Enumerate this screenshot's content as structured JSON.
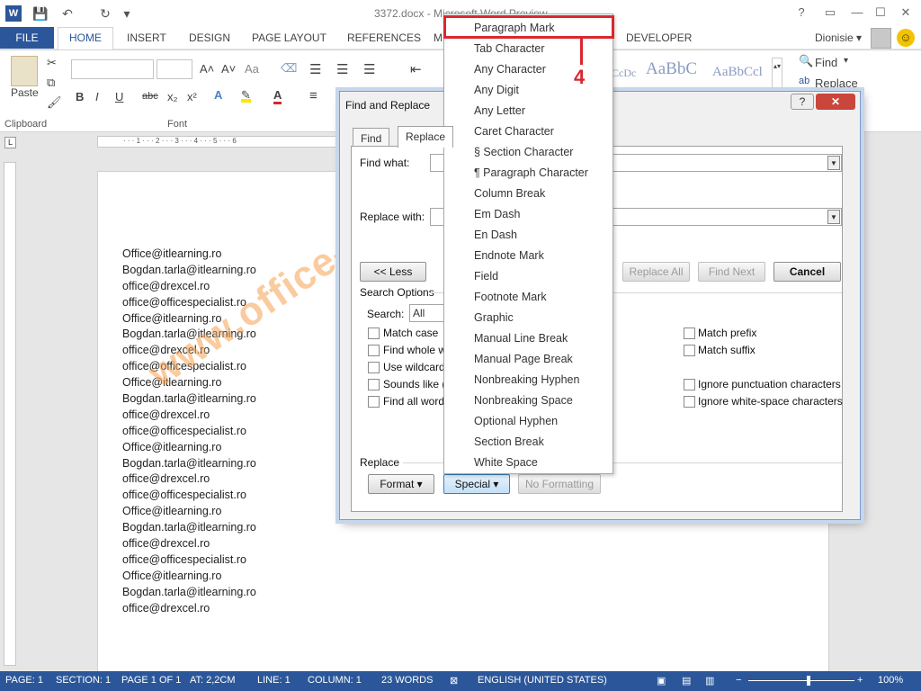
{
  "window": {
    "title": "3372.docx - Microsoft Word Preview",
    "controls": [
      "?",
      "▭",
      "—",
      "☐",
      "✕"
    ]
  },
  "qat": {
    "logo": "W",
    "save_icon": "💾",
    "undo_icon": "↶",
    "redo_icon": "↻",
    "customize_icon": "▾"
  },
  "tabs": {
    "file": "FILE",
    "home": "HOME",
    "items": [
      "INSERT",
      "DESIGN",
      "PAGE LAYOUT",
      "REFERENCES",
      "M",
      "DEVELOPER"
    ]
  },
  "user": {
    "name": "Dionisie ▾",
    "smile": "☺"
  },
  "ribbon": {
    "paste": "Paste",
    "group_labels": {
      "clipboard": "Clipboard",
      "font": "Font"
    },
    "font_buttons": [
      "B",
      "I",
      "U",
      "abc",
      "x₂",
      "x²"
    ],
    "grow_font": "A˄",
    "shrink_font": "A˅",
    "change_case": "Aa",
    "styles": [
      "CcDc",
      "AaBbC",
      "AaBbCcl"
    ],
    "find": "Find",
    "find_arrow": "▾",
    "replace": "Replace"
  },
  "ruler": {
    "marks": "· · · 1 · · · 2 · · · 3 · · · 4 · · · 5 · · · 6"
  },
  "document": {
    "lines": [
      "Office@itlearning.ro",
      "Bogdan.tarla@itlearning.ro",
      "office@drexcel.ro",
      "office@officespecialist.ro",
      "Office@itlearning.ro",
      "Bogdan.tarla@itlearning.ro",
      "office@drexcel.ro",
      "office@officespecialist.ro",
      "Office@itlearning.ro",
      "Bogdan.tarla@itlearning.ro",
      "office@drexcel.ro",
      "office@officespecialist.ro",
      "Office@itlearning.ro",
      "Bogdan.tarla@itlearning.ro",
      "office@drexcel.ro",
      "office@officespecialist.ro",
      "Office@itlearning.ro",
      "Bogdan.tarla@itlearning.ro",
      "office@drexcel.ro",
      "office@officespecialist.ro",
      "Office@itlearning.ro",
      "Bogdan.tarla@itlearning.ro",
      "office@drexcel.ro"
    ]
  },
  "watermark": "www.office-learning.ro",
  "dialog": {
    "title": "Find and Replace",
    "help": "?",
    "close": "✕",
    "tab_find": "Find",
    "tab_replace": "Replace",
    "find_what": "Find what:",
    "replace_with": "Replace with:",
    "less_button": "<< Less",
    "replace_all": "Replace All",
    "find_next": "Find Next",
    "cancel": "Cancel",
    "search_options": "Search Options",
    "search_label": "Search:",
    "search_value": "All",
    "left_options": [
      "Match case",
      "Find whole w",
      "Use wildcard",
      "Sounds like (",
      "Find all word"
    ],
    "right_options_top": [
      "Match prefix",
      "Match suffix"
    ],
    "right_options_bottom": [
      "Ignore punctuation characters",
      "Ignore white-space characters"
    ],
    "replace_section": "Replace",
    "format_button": "Format ▾",
    "special_button": "Special ▾",
    "no_formatting": "No Formatting"
  },
  "special_menu": [
    "Paragraph Mark",
    "Tab Character",
    "Any Character",
    "Any Digit",
    "Any Letter",
    "Caret Character",
    "§ Section Character",
    "¶ Paragraph Character",
    "Column Break",
    "Em Dash",
    "En Dash",
    "Endnote Mark",
    "Field",
    "Footnote Mark",
    "Graphic",
    "Manual Line Break",
    "Manual Page Break",
    "Nonbreaking Hyphen",
    "Nonbreaking Space",
    "Optional Hyphen",
    "Section Break",
    "White Space"
  ],
  "callout": {
    "number": "4",
    "color": "#d9272f"
  },
  "statusbar": {
    "page": "PAGE: 1",
    "section": "SECTION: 1",
    "page_of": "PAGE 1 OF 1",
    "at": "AT: 2,2CM",
    "line": "LINE: 1",
    "column": "COLUMN: 1",
    "words": "23 WORDS",
    "language": "ENGLISH (UNITED STATES)",
    "zoom": "100%",
    "zoom_out": "−",
    "zoom_in": "+"
  },
  "colors": {
    "accent": "#2b579a",
    "highlight": "#d9272f",
    "watermark": "#f5a050"
  }
}
